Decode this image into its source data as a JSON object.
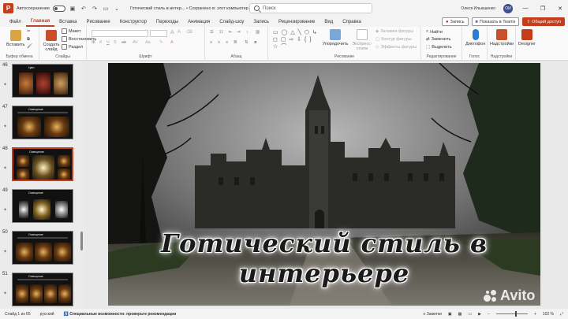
{
  "titlebar": {
    "autosave_label": "Автосохранение",
    "doc_title": "Готический стиль в интер... • Сохранено в: этот компьютер ˅",
    "search_placeholder": "Поиск",
    "user_name": "Олеся Ильюшенко",
    "avatar_initials": "ОИ"
  },
  "tabs": [
    "Файл",
    "Главная",
    "Вставка",
    "Рисование",
    "Конструктор",
    "Переходы",
    "Анимация",
    "Слайд-шоу",
    "Запись",
    "Рецензирование",
    "Вид",
    "Справка"
  ],
  "tab_actions": {
    "record": "Запись",
    "teams": "Показать в Teams",
    "share": "Общий доступ"
  },
  "ribbon": {
    "clipboard": {
      "paste": "Вставить",
      "label": "Буфер обмена"
    },
    "slides": {
      "new_slide": "Создать слайд",
      "layout": "Макет",
      "reset": "Восстановить",
      "section": "Раздел",
      "label": "Слайды"
    },
    "font": {
      "label": "Шрифт"
    },
    "paragraph": {
      "label": "Абзац"
    },
    "drawing": {
      "arrange": "Упорядочить",
      "quick_styles": "Экспресс-стили",
      "fill": "Заливка фигуры",
      "outline": "Контур фигуры",
      "effects": "Эффекты фигуры",
      "label": "Рисование"
    },
    "editing": {
      "find": "Найти",
      "replace": "Заменить",
      "select": "Выделить",
      "label": "Редактирование"
    },
    "voice": {
      "dictate": "Диктофон",
      "label": "Голос"
    },
    "addins": {
      "addins": "Надстройки",
      "label": "Надстройки"
    },
    "designer": {
      "label": "Designer"
    }
  },
  "thumbnails": [
    {
      "num": "46",
      "title": "Цвет"
    },
    {
      "num": "47",
      "title": "Освещение"
    },
    {
      "num": "48",
      "title": "Освещение"
    },
    {
      "num": "49",
      "title": "Освещение"
    },
    {
      "num": "50",
      "title": "Освещение"
    },
    {
      "num": "51",
      "title": "Освещение"
    }
  ],
  "slide": {
    "title": "Готический стиль в интерьере"
  },
  "status": {
    "slide_count": "Слайд 1 из 65",
    "language": "русский",
    "accessibility": "Специальные возможности: проверьте рекомендации",
    "notes": "Заметки",
    "zoom": "102 %"
  },
  "watermark": "Avito"
}
